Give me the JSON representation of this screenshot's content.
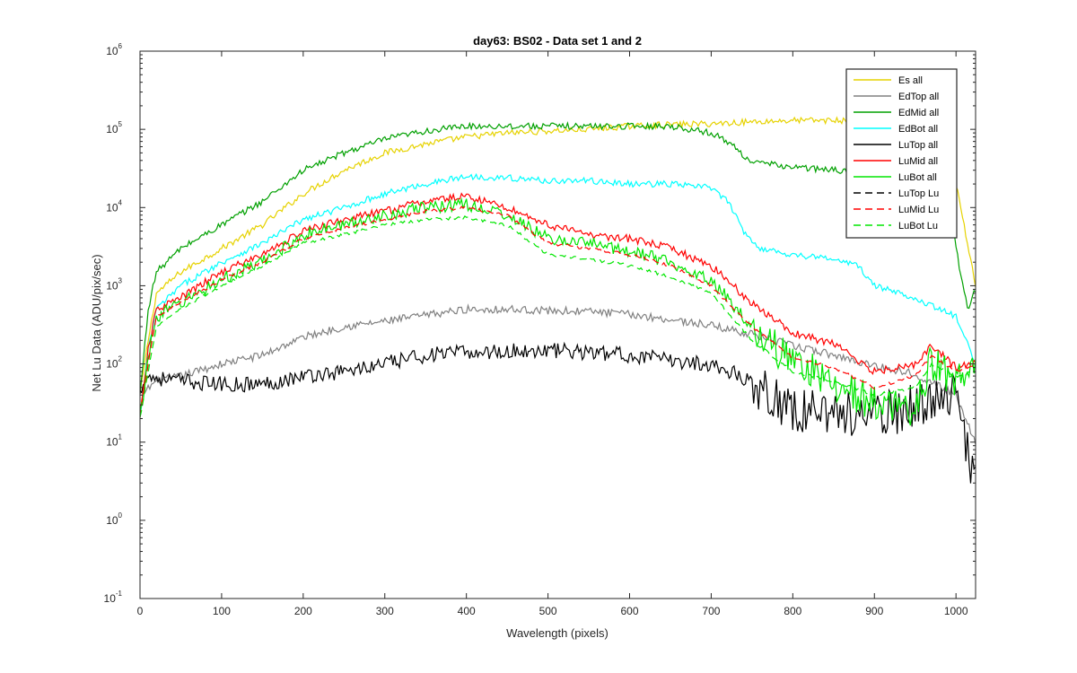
{
  "chart_data": {
    "type": "line",
    "title": "day63: BS02 - Data set 1 and 2",
    "xlabel": "Wavelength (pixels)",
    "ylabel": "Net Lu Data (ADU/pix/sec)",
    "xlim": [
      0,
      1024
    ],
    "ylim": [
      0.1,
      1000000
    ],
    "yscale": "log",
    "xticks": [
      0,
      100,
      200,
      300,
      400,
      500,
      600,
      700,
      800,
      900,
      1000
    ],
    "yticks": [
      {
        "value": 0.1,
        "base": "10",
        "exp": "-1"
      },
      {
        "value": 1,
        "base": "10",
        "exp": "0"
      },
      {
        "value": 10,
        "base": "10",
        "exp": "1"
      },
      {
        "value": 100,
        "base": "10",
        "exp": "2"
      },
      {
        "value": 1000,
        "base": "10",
        "exp": "3"
      },
      {
        "value": 10000,
        "base": "10",
        "exp": "4"
      },
      {
        "value": 100000,
        "base": "10",
        "exp": "5"
      },
      {
        "value": 1000000,
        "base": "10",
        "exp": "6"
      }
    ],
    "grid": false,
    "legend_position": "top-right",
    "series": [
      {
        "name": "Es  all",
        "color": "#e6d200",
        "dash": "solid",
        "noise": 0.04,
        "points": [
          [
            0,
            40
          ],
          [
            10,
            200
          ],
          [
            20,
            800
          ],
          [
            50,
            1500
          ],
          [
            100,
            3000
          ],
          [
            150,
            6000
          ],
          [
            200,
            15000
          ],
          [
            250,
            30000
          ],
          [
            300,
            50000
          ],
          [
            350,
            65000
          ],
          [
            400,
            80000
          ],
          [
            450,
            90000
          ],
          [
            500,
            95000
          ],
          [
            550,
            100000
          ],
          [
            600,
            110000
          ],
          [
            650,
            115000
          ],
          [
            700,
            118000
          ],
          [
            750,
            125000
          ],
          [
            800,
            130000
          ],
          [
            850,
            130000
          ],
          [
            900,
            130000
          ],
          [
            950,
            125000
          ],
          [
            980,
            100000
          ],
          [
            1000,
            20000
          ],
          [
            1024,
            1000
          ]
        ]
      },
      {
        "name": "EdTop  all",
        "color": "#808080",
        "dash": "solid",
        "noise": 0.05,
        "points": [
          [
            0,
            40
          ],
          [
            20,
            60
          ],
          [
            50,
            70
          ],
          [
            100,
            100
          ],
          [
            150,
            130
          ],
          [
            200,
            220
          ],
          [
            250,
            300
          ],
          [
            300,
            350
          ],
          [
            350,
            420
          ],
          [
            400,
            500
          ],
          [
            450,
            500
          ],
          [
            500,
            480
          ],
          [
            550,
            470
          ],
          [
            600,
            430
          ],
          [
            650,
            370
          ],
          [
            700,
            310
          ],
          [
            750,
            240
          ],
          [
            800,
            170
          ],
          [
            850,
            130
          ],
          [
            900,
            95
          ],
          [
            950,
            75
          ],
          [
            1000,
            40
          ],
          [
            1024,
            10
          ]
        ]
      },
      {
        "name": "EdMid  all",
        "color": "#00a000",
        "dash": "solid",
        "noise": 0.04,
        "points": [
          [
            0,
            40
          ],
          [
            10,
            500
          ],
          [
            20,
            1500
          ],
          [
            50,
            3000
          ],
          [
            100,
            6000
          ],
          [
            150,
            12000
          ],
          [
            200,
            30000
          ],
          [
            250,
            50000
          ],
          [
            300,
            75000
          ],
          [
            350,
            95000
          ],
          [
            400,
            110000
          ],
          [
            450,
            110000
          ],
          [
            500,
            110000
          ],
          [
            550,
            110000
          ],
          [
            600,
            110000
          ],
          [
            650,
            110000
          ],
          [
            700,
            90000
          ],
          [
            720,
            70000
          ],
          [
            750,
            38000
          ],
          [
            800,
            33000
          ],
          [
            850,
            30000
          ],
          [
            900,
            28000
          ],
          [
            950,
            25000
          ],
          [
            990,
            15000
          ],
          [
            1005,
            1500
          ],
          [
            1015,
            500
          ],
          [
            1024,
            900
          ]
        ]
      },
      {
        "name": "EdBot  all",
        "color": "#00ffff",
        "dash": "solid",
        "noise": 0.04,
        "points": [
          [
            0,
            20
          ],
          [
            10,
            150
          ],
          [
            20,
            500
          ],
          [
            50,
            1000
          ],
          [
            100,
            2000
          ],
          [
            150,
            3500
          ],
          [
            200,
            7000
          ],
          [
            250,
            10000
          ],
          [
            300,
            15000
          ],
          [
            350,
            20000
          ],
          [
            400,
            25000
          ],
          [
            450,
            24000
          ],
          [
            500,
            22000
          ],
          [
            550,
            22000
          ],
          [
            600,
            20000
          ],
          [
            650,
            20000
          ],
          [
            700,
            18000
          ],
          [
            720,
            12000
          ],
          [
            740,
            5000
          ],
          [
            760,
            3000
          ],
          [
            800,
            2500
          ],
          [
            850,
            2200
          ],
          [
            880,
            1800
          ],
          [
            900,
            1000
          ],
          [
            950,
            700
          ],
          [
            1000,
            400
          ],
          [
            1024,
            100
          ]
        ]
      },
      {
        "name": "LuTop  all",
        "color": "#000000",
        "dash": "solid",
        "noise": 0.1,
        "points": [
          [
            0,
            40
          ],
          [
            5,
            70
          ],
          [
            50,
            60
          ],
          [
            100,
            55
          ],
          [
            150,
            55
          ],
          [
            200,
            70
          ],
          [
            250,
            80
          ],
          [
            300,
            100
          ],
          [
            350,
            130
          ],
          [
            400,
            140
          ],
          [
            450,
            145
          ],
          [
            500,
            150
          ],
          [
            550,
            140
          ],
          [
            600,
            130
          ],
          [
            650,
            110
          ],
          [
            700,
            100
          ],
          [
            750,
            60
          ],
          [
            800,
            25
          ],
          [
            850,
            25
          ],
          [
            900,
            20
          ],
          [
            950,
            30
          ],
          [
            1000,
            40
          ],
          [
            1024,
            3
          ]
        ]
      },
      {
        "name": "LuMid  all",
        "color": "#ff0000",
        "dash": "solid",
        "noise": 0.05,
        "points": [
          [
            0,
            20
          ],
          [
            10,
            150
          ],
          [
            20,
            500
          ],
          [
            50,
            700
          ],
          [
            100,
            1500
          ],
          [
            150,
            2500
          ],
          [
            200,
            5000
          ],
          [
            250,
            7000
          ],
          [
            300,
            9000
          ],
          [
            350,
            12000
          ],
          [
            400,
            14000
          ],
          [
            450,
            10000
          ],
          [
            500,
            6000
          ],
          [
            550,
            4500
          ],
          [
            600,
            4000
          ],
          [
            650,
            3000
          ],
          [
            700,
            1800
          ],
          [
            750,
            600
          ],
          [
            800,
            250
          ],
          [
            850,
            180
          ],
          [
            900,
            80
          ],
          [
            950,
            100
          ],
          [
            970,
            170
          ],
          [
            1000,
            90
          ],
          [
            1024,
            100
          ]
        ]
      },
      {
        "name": "LuBot  all",
        "color": "#00e600",
        "dash": "solid",
        "noise": 0.08,
        "points": [
          [
            0,
            20
          ],
          [
            10,
            120
          ],
          [
            20,
            400
          ],
          [
            50,
            600
          ],
          [
            100,
            1200
          ],
          [
            150,
            2000
          ],
          [
            200,
            4500
          ],
          [
            250,
            6000
          ],
          [
            300,
            8000
          ],
          [
            350,
            10000
          ],
          [
            400,
            11000
          ],
          [
            450,
            8000
          ],
          [
            500,
            4000
          ],
          [
            550,
            3500
          ],
          [
            600,
            2800
          ],
          [
            650,
            2000
          ],
          [
            700,
            1200
          ],
          [
            750,
            300
          ],
          [
            800,
            100
          ],
          [
            850,
            60
          ],
          [
            900,
            30
          ],
          [
            950,
            25
          ],
          [
            970,
            110
          ],
          [
            1000,
            60
          ],
          [
            1024,
            100
          ]
        ]
      },
      {
        "name": "LuTop  Lu",
        "color": "#000000",
        "dash": "8,5",
        "noise": 0,
        "hidden": true,
        "points": [
          [
            0,
            40
          ],
          [
            1024,
            40
          ]
        ]
      },
      {
        "name": "LuMid  Lu",
        "color": "#ff0000",
        "dash": "8,5",
        "noise": 0.02,
        "points": [
          [
            0,
            20
          ],
          [
            10,
            100
          ],
          [
            20,
            400
          ],
          [
            50,
            600
          ],
          [
            100,
            1200
          ],
          [
            150,
            2000
          ],
          [
            200,
            4000
          ],
          [
            250,
            5500
          ],
          [
            300,
            7000
          ],
          [
            350,
            9000
          ],
          [
            400,
            10000
          ],
          [
            450,
            8000
          ],
          [
            500,
            3500
          ],
          [
            550,
            3000
          ],
          [
            600,
            2500
          ],
          [
            650,
            1800
          ],
          [
            700,
            1000
          ],
          [
            750,
            300
          ],
          [
            800,
            120
          ],
          [
            850,
            90
          ],
          [
            900,
            50
          ],
          [
            950,
            70
          ],
          [
            970,
            130
          ],
          [
            1000,
            80
          ],
          [
            1024,
            100
          ]
        ]
      },
      {
        "name": "LuBot  Lu",
        "color": "#00e600",
        "dash": "8,5",
        "noise": 0.02,
        "points": [
          [
            0,
            20
          ],
          [
            10,
            80
          ],
          [
            20,
            300
          ],
          [
            50,
            500
          ],
          [
            100,
            1000
          ],
          [
            150,
            1800
          ],
          [
            200,
            3500
          ],
          [
            250,
            4500
          ],
          [
            300,
            6000
          ],
          [
            350,
            7000
          ],
          [
            400,
            7500
          ],
          [
            450,
            6000
          ],
          [
            500,
            2500
          ],
          [
            550,
            2200
          ],
          [
            600,
            1800
          ],
          [
            650,
            1300
          ],
          [
            700,
            800
          ],
          [
            750,
            200
          ],
          [
            800,
            80
          ],
          [
            850,
            60
          ],
          [
            900,
            40
          ],
          [
            950,
            50
          ],
          [
            970,
            100
          ],
          [
            1000,
            70
          ],
          [
            1024,
            80
          ]
        ]
      }
    ]
  }
}
